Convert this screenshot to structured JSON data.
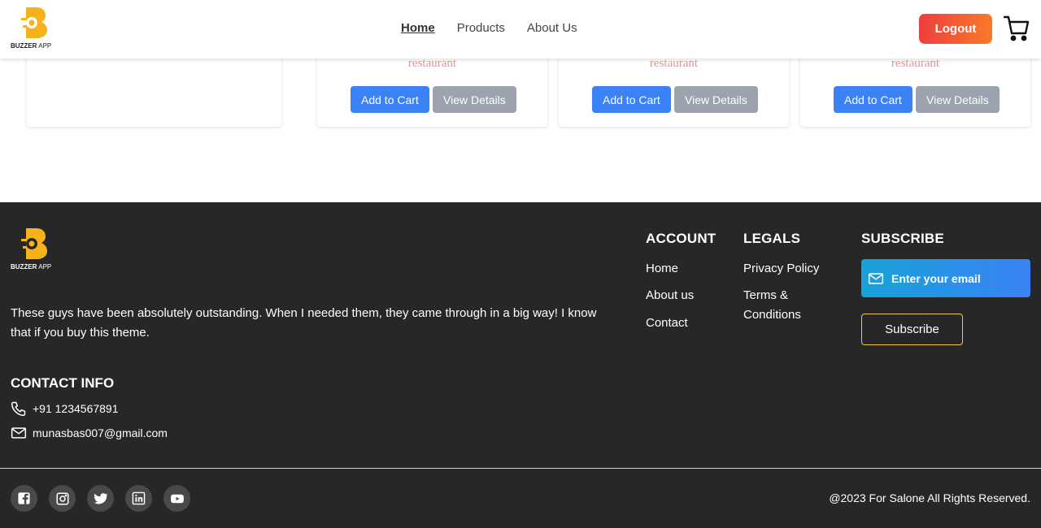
{
  "brand": {
    "name_bold": "BUZZER",
    "name_rest": " APP",
    "accent": "#f5b21b"
  },
  "nav": {
    "items": [
      {
        "label": "Home",
        "active": true
      },
      {
        "label": "Products",
        "active": false
      },
      {
        "label": "About Us",
        "active": false
      }
    ],
    "logout_label": "Logout"
  },
  "products": {
    "cards": [
      {
        "category": "restaurant",
        "add_label": "Add to Cart",
        "view_label": "View Details"
      },
      {
        "category": "restaurant",
        "add_label": "Add to Cart",
        "view_label": "View Details"
      },
      {
        "category": "restaurant",
        "add_label": "Add to Cart",
        "view_label": "View Details"
      }
    ]
  },
  "footer": {
    "about_text": "These guys have been absolutely outstanding. When I needed them, they came through in a big way! I know that if you buy this theme.",
    "contact": {
      "heading": "CONTACT INFO",
      "phone": "+91 1234567891",
      "email": "munasbas007@gmail.com"
    },
    "account": {
      "heading": "ACCOUNT",
      "links": [
        "Home",
        "About us",
        "Contact"
      ]
    },
    "legals": {
      "heading": "LEGALS",
      "links": [
        "Privacy Policy",
        "Terms & Conditions"
      ]
    },
    "subscribe": {
      "heading": "SUBSCRIBE",
      "placeholder": "Enter your email",
      "button_label": "Subscribe"
    },
    "socials": [
      "facebook-icon",
      "instagram-icon",
      "twitter-icon",
      "linkedin-icon",
      "youtube-icon"
    ],
    "copyright": "@2023 For Salone All Rights Reserved."
  }
}
